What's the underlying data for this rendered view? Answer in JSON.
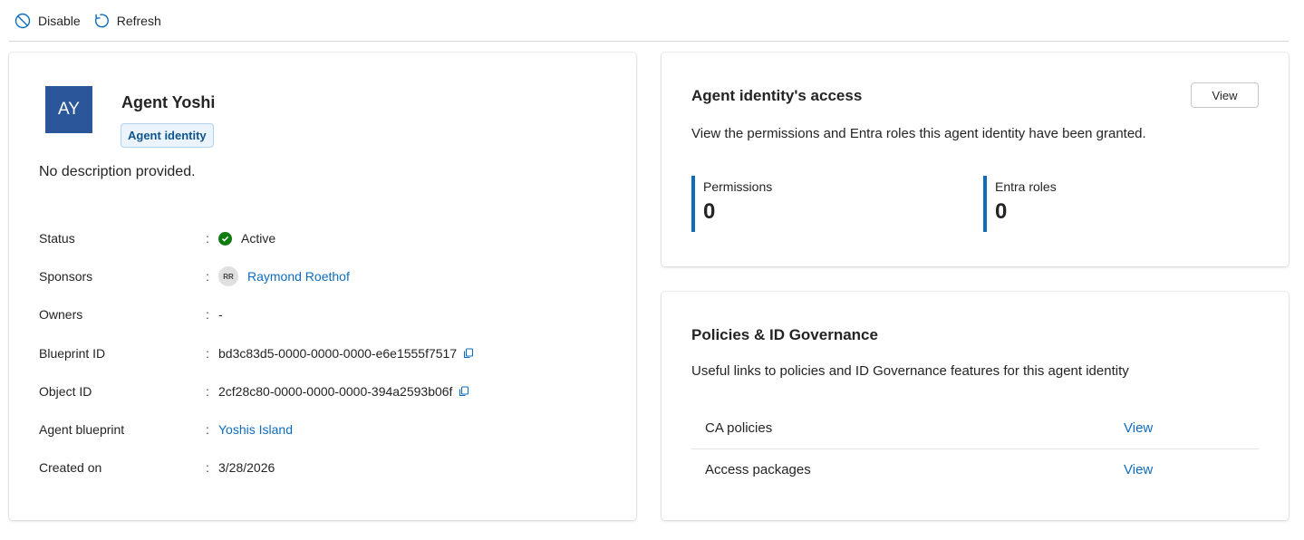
{
  "toolbar": {
    "disable_label": "Disable",
    "refresh_label": "Refresh"
  },
  "colors": {
    "accent": "#0f6cbd",
    "avatar_bg": "#2b579a",
    "status_active": "#107c10"
  },
  "identity": {
    "initials": "AY",
    "name": "Agent Yoshi",
    "tag": "Agent identity",
    "description": "No description provided."
  },
  "properties": {
    "separator": ":",
    "status": {
      "label": "Status",
      "value": "Active",
      "icon": "check-circle-icon"
    },
    "sponsors": {
      "label": "Sponsors",
      "initials": "RR",
      "value": "Raymond Roethof"
    },
    "owners": {
      "label": "Owners",
      "value": "-"
    },
    "blueprint_id": {
      "label": "Blueprint ID",
      "value": "bd3c83d5-0000-0000-0000-e6e1555f7517",
      "icon": "copy-icon"
    },
    "object_id": {
      "label": "Object ID",
      "value": "2cf28c80-0000-0000-0000-394a2593b06f",
      "icon": "copy-icon"
    },
    "agent_blueprint": {
      "label": "Agent blueprint",
      "value": "Yoshis Island"
    },
    "created_on": {
      "label": "Created on",
      "value": "3/28/2026"
    }
  },
  "access": {
    "title": "Agent identity's access",
    "view_label": "View",
    "subtitle": "View the permissions and Entra roles this agent identity have been granted.",
    "metrics": [
      {
        "label": "Permissions",
        "value": "0"
      },
      {
        "label": "Entra roles",
        "value": "0"
      }
    ]
  },
  "governance": {
    "title": "Policies & ID Governance",
    "subtitle": "Useful links to policies and ID Governance features for this agent identity",
    "links": [
      {
        "name": "CA policies",
        "action": "View"
      },
      {
        "name": "Access packages",
        "action": "View"
      }
    ]
  }
}
